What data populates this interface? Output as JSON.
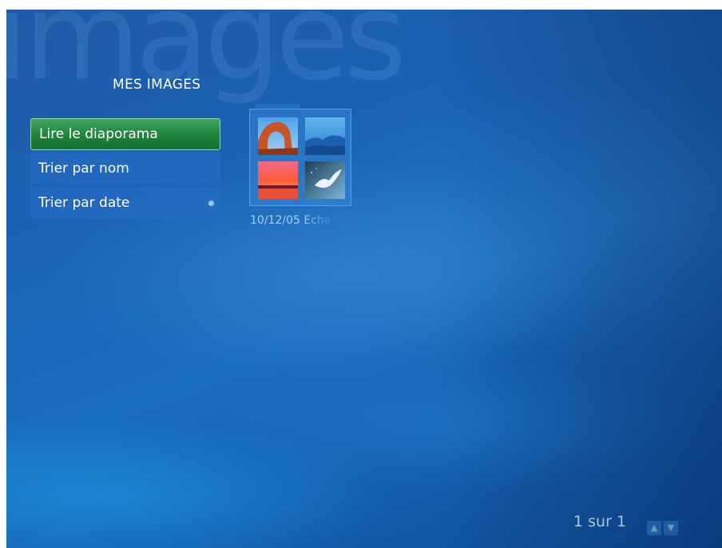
{
  "watermark": "images",
  "title": "MES IMAGES",
  "menu": {
    "items": [
      {
        "label": "Lire le diaporama"
      },
      {
        "label": "Trier par nom"
      },
      {
        "label": "Trier par date"
      }
    ]
  },
  "folder": {
    "date": "10/12/05",
    "name_partial": "Écha"
  },
  "pager": {
    "text": "1 sur 1"
  },
  "colors": {
    "background": "#1a6ec0",
    "selected": "#20823c",
    "menu_item": "#2e6ec8"
  },
  "icons": {
    "up": "chevron-up-icon",
    "down": "chevron-down-icon"
  }
}
